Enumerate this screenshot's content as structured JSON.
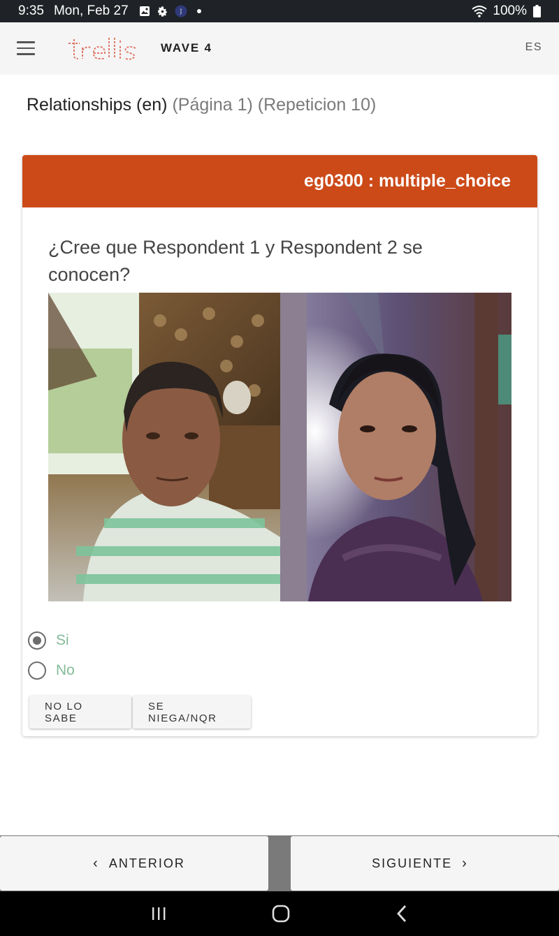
{
  "status_bar": {
    "time": "9:35",
    "date": "Mon, Feb 27",
    "battery": "100%",
    "icons": [
      "gallery-icon",
      "settings-gear-icon",
      "app-notification-icon",
      "wifi-icon",
      "battery-icon"
    ]
  },
  "app_bar": {
    "logo_text": "trellis",
    "study_title": "WAVE 4",
    "language_toggle": "ES",
    "accent_color": "#e07b6c"
  },
  "page": {
    "section": "Relationships (en)",
    "page_label": "(Página 1)",
    "repetition_label": "(Repeticion 10)"
  },
  "question": {
    "header": "eg0300 : multiple_choice",
    "header_color": "#cc4a18",
    "text": "¿Cree que Respondent 1 y Respondent 2 se conocen?",
    "photos": [
      "respondent-1-photo",
      "respondent-2-photo"
    ],
    "options": [
      {
        "label": "Si",
        "selected": true
      },
      {
        "label": "No",
        "selected": false
      }
    ],
    "option_color": "#84bb98",
    "buttons": {
      "dont_know": "NO LO SABE",
      "refused": "SE NIEGA/NQR"
    }
  },
  "navigation": {
    "previous": "ANTERIOR",
    "next": "SIGUIENTE"
  },
  "system_nav": {
    "icons": [
      "recent-apps-icon",
      "home-icon",
      "back-icon"
    ]
  }
}
